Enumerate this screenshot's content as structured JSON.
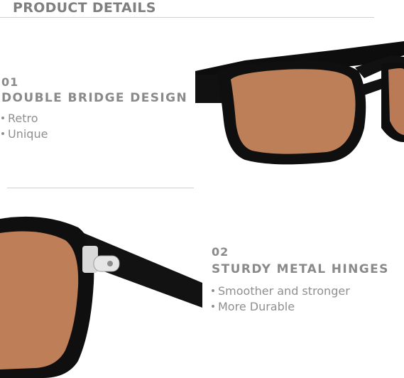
{
  "header": {
    "title": "PRODUCT DETAILS"
  },
  "features": [
    {
      "number": "01",
      "title": "DOUBLE BRIDGE DESIGN",
      "bullets": [
        "Retro",
        "Unique"
      ]
    },
    {
      "number": "02",
      "title": "STURDY METAL HINGES",
      "bullets": [
        "Smoother and stronger",
        "More Durable"
      ]
    }
  ],
  "colors": {
    "lens": "#bf7f59",
    "frame": "#111111",
    "text": "#8a8a8a",
    "background": "#ffffff"
  },
  "images": [
    {
      "name": "double-bridge-sunglasses-closeup"
    },
    {
      "name": "metal-hinge-sunglasses-closeup"
    }
  ]
}
